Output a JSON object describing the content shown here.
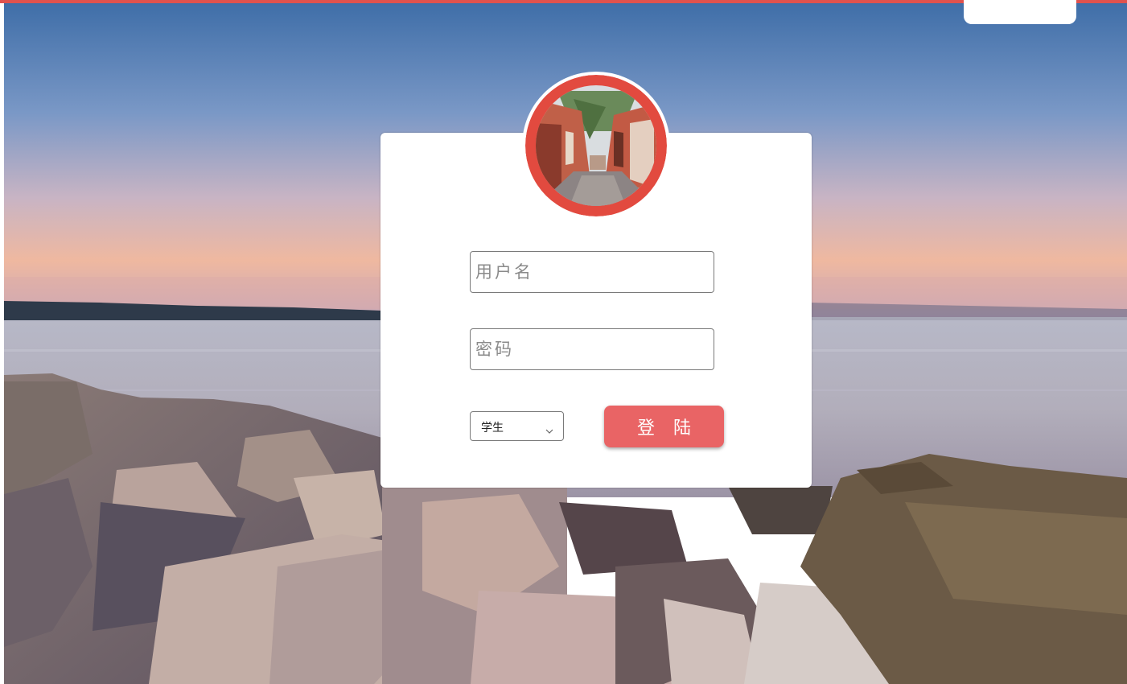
{
  "theme": {
    "accent": "#e0524e",
    "button_bg": "#e96465",
    "avatar_border": "#e24a3f"
  },
  "login": {
    "username_placeholder": "用户名",
    "password_placeholder": "密码",
    "role_selected": "学生",
    "submit_label": "登 陆"
  },
  "icons": {
    "role_dropdown": "chevron-down-icon",
    "avatar": "street-photo-avatar"
  }
}
